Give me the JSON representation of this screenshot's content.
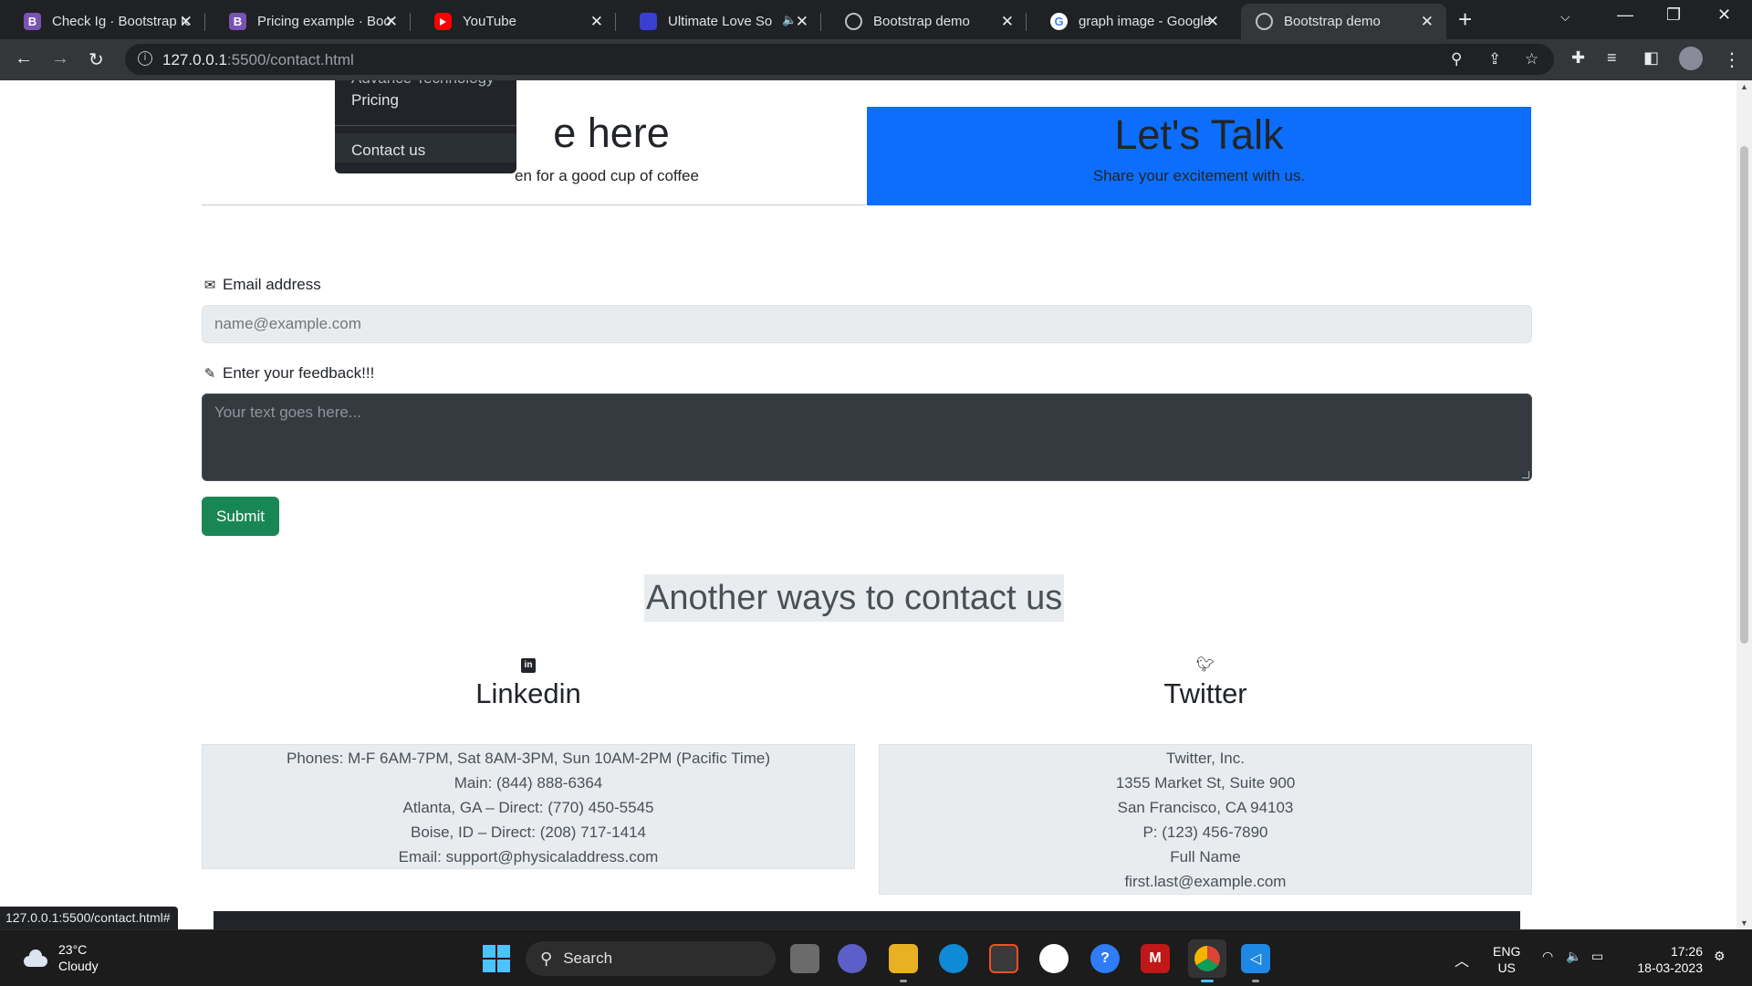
{
  "browser": {
    "tabs": [
      {
        "title": "Check Ig · Bootstrap Ic",
        "favicon": "bootstrap-icon",
        "active": false
      },
      {
        "title": "Pricing example · Boot",
        "favicon": "bootstrap-icon",
        "active": false
      },
      {
        "title": "YouTube",
        "favicon": "youtube-icon",
        "active": false
      },
      {
        "title": "Ultimate Love Son",
        "favicon": "music-icon",
        "active": false,
        "audio": true
      },
      {
        "title": "Bootstrap demo",
        "favicon": "globe-icon",
        "active": false
      },
      {
        "title": "graph image - Google",
        "favicon": "google-icon",
        "active": false
      },
      {
        "title": "Bootstrap demo",
        "favicon": "globe-icon",
        "active": true
      }
    ],
    "favicon_letter": "B",
    "google_letter": "G",
    "url_host": "127.0.0.1",
    "url_rest": ":5500/contact.html",
    "status_url": "127.0.0.1:5500/contact.html#"
  },
  "page": {
    "dropdown": {
      "cut_item": "Advance Technology",
      "items": [
        "Pricing",
        "Contact us"
      ]
    },
    "hero_left": {
      "title": "e here",
      "subtitle": "en for a good cup of coffee"
    },
    "hero_right": {
      "title": "Let's Talk",
      "subtitle": "Share your excitement with us."
    },
    "form": {
      "email_label": "Email address",
      "email_placeholder": "name@example.com",
      "feedback_label": "Enter your feedback!!!",
      "feedback_placeholder": "Your text goes here...",
      "submit_label": "Submit"
    },
    "other_ways_title": "Another ways to contact us",
    "linkedin": {
      "heading": "Linkedin",
      "lines": [
        "Phones: M-F 6AM-7PM, Sat 8AM-3PM, Sun 10AM-2PM (Pacific Time)",
        "Main: (844) 888-6364",
        "Atlanta, GA – Direct: (770) 450-5545",
        "Boise, ID – Direct: (208) 717-1414",
        "Email: support@physicaladdress.com"
      ]
    },
    "twitter": {
      "heading": "Twitter",
      "lines": [
        "Twitter, Inc.",
        "1355 Market St, Suite 900",
        "San Francisco, CA 94103",
        "P: (123) 456-7890",
        "Full Name",
        "first.last@example.com"
      ]
    }
  },
  "taskbar": {
    "weather_temp": "23°C",
    "weather_desc": "Cloudy",
    "search_label": "Search",
    "lang_top": "ENG",
    "lang_bottom": "US",
    "time": "17:26",
    "date": "18-03-2023"
  },
  "colors": {
    "primary": "#0d6efd",
    "success": "#198754",
    "dark": "#212529"
  }
}
